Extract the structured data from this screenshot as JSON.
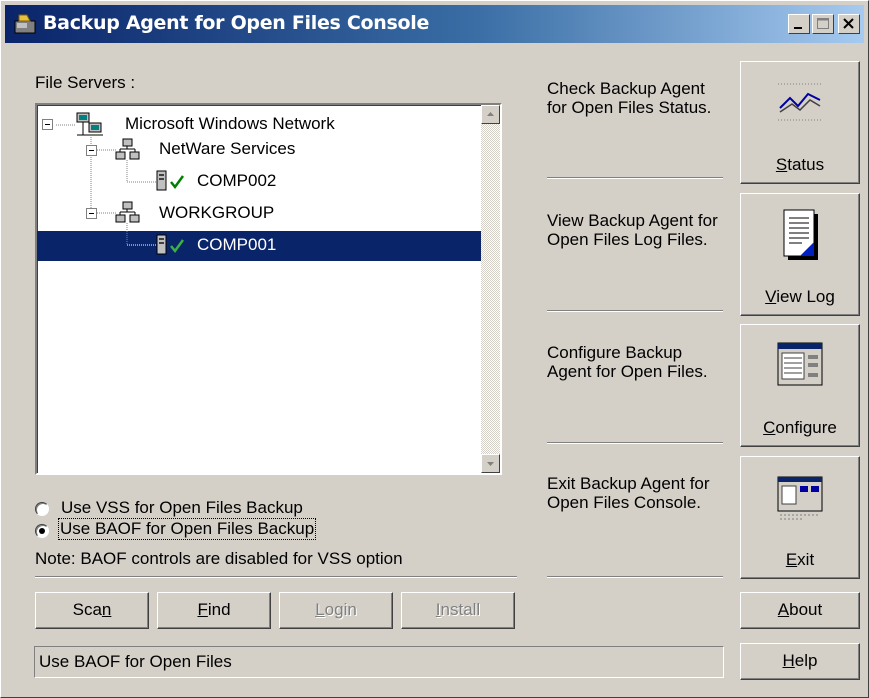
{
  "window": {
    "title": "Backup Agent for Open Files Console"
  },
  "file_servers_label": "File Servers :",
  "tree": {
    "root": "Microsoft Windows Network",
    "groups": [
      {
        "label": "NetWare Services",
        "children": [
          "COMP002"
        ]
      },
      {
        "label": "WORKGROUP",
        "children": [
          "COMP001"
        ]
      }
    ],
    "selected": "COMP001"
  },
  "options": {
    "vss_label": "Use VSS for Open Files Backup",
    "baof_label": "Use BAOF for Open Files Backup",
    "selected": "baof",
    "note": "Note: BAOF controls are disabled for VSS option"
  },
  "bottom_buttons": {
    "scan": {
      "pre": "Sca",
      "key": "n",
      "post": ""
    },
    "find": {
      "pre": "",
      "key": "F",
      "post": "ind"
    },
    "login": {
      "pre": "",
      "key": "L",
      "post": "ogin",
      "disabled": true
    },
    "install": {
      "pre": "",
      "key": "I",
      "post": "nstall",
      "disabled": true
    }
  },
  "actions": [
    {
      "desc": "Check Backup Agent for Open Files Status.",
      "label_key": "S",
      "label_rest": "tatus",
      "icon": "status-graph-icon"
    },
    {
      "desc": "View Backup Agent for Open Files Log Files.",
      "label_key": "V",
      "label_rest": "iew Log",
      "icon": "log-document-icon"
    },
    {
      "desc": "Configure Backup Agent for Open Files.",
      "label_key": "C",
      "label_rest": "onfigure",
      "icon": "configure-window-icon"
    },
    {
      "desc": "Exit Backup Agent for Open Files Console.",
      "label_key": "E",
      "label_rest": "xit",
      "icon": "exit-window-icon"
    }
  ],
  "about": {
    "key": "A",
    "rest": "bout"
  },
  "help": {
    "key": "H",
    "rest": "elp"
  },
  "status_bar": "Use BAOF for Open Files"
}
